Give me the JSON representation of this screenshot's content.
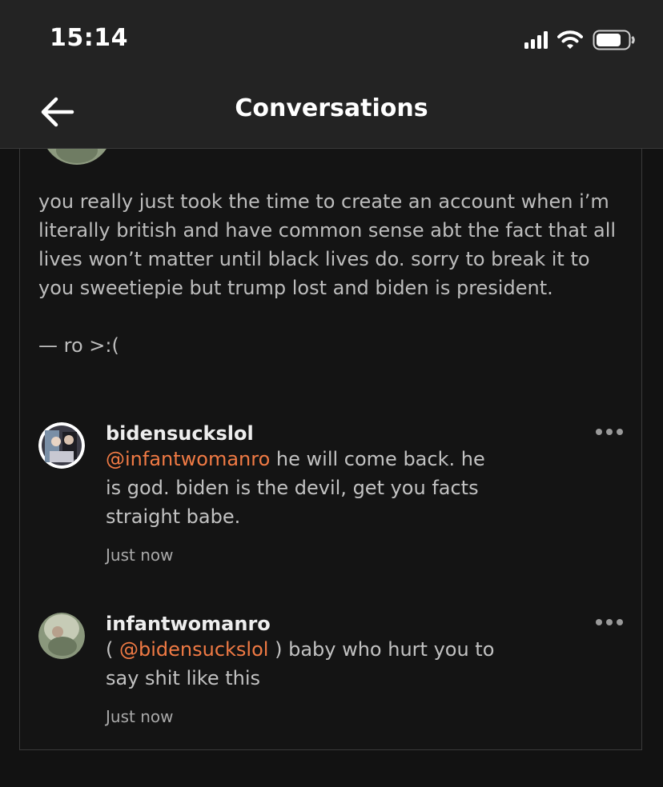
{
  "status_bar": {
    "time": "15:14",
    "signal_icon": "cellular-signal-icon",
    "wifi_icon": "wifi-icon",
    "battery_icon": "battery-icon"
  },
  "header": {
    "back_icon": "back-arrow-icon",
    "title": "Conversations"
  },
  "post": {
    "body": "you really just took the time to create an account when i’m literally british and have common sense abt the fact that all lives won’t matter until black lives do. sorry to break it to you sweetiepie but trump lost and biden is president.",
    "signature": "— ro >:("
  },
  "comments": [
    {
      "username": "bidensuckslol",
      "prefix": "",
      "mention": "@infantwomanro",
      "suffix": "",
      "text": " he will come back. he is god. biden is the devil, get you facts straight babe.",
      "time": "Just now",
      "more_icon": "more-options-icon"
    },
    {
      "username": "infantwomanro",
      "prefix": "( ",
      "mention": "@bidensuckslol",
      "suffix": " )",
      "text": " baby who hurt you to say shit like this",
      "time": "Just now",
      "more_icon": "more-options-icon"
    }
  ],
  "colors": {
    "background": "#121212",
    "header": "#232323",
    "mention": "#f07a44"
  }
}
